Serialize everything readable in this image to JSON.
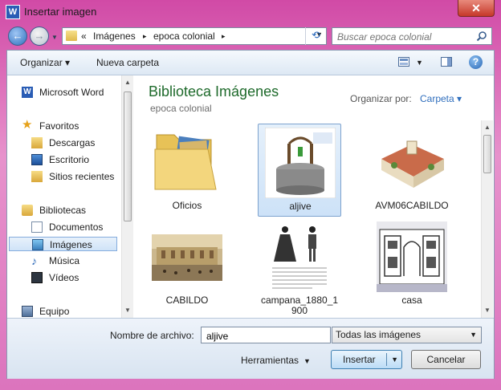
{
  "window": {
    "title": "Insertar imagen",
    "app_icon": "W",
    "close_glyph": "✕"
  },
  "nav": {
    "back_glyph": "←",
    "forward_glyph": "→",
    "breadcrumb": {
      "prefix": "«",
      "parts": [
        "Imágenes",
        "epoca colonial"
      ],
      "sep": "▸"
    },
    "refresh_glyph": "⟲",
    "search_placeholder": "Buscar epoca colonial"
  },
  "toolbar": {
    "organize": "Organizar ▾",
    "new_folder": "Nueva carpeta",
    "help": "?"
  },
  "sidebar": {
    "items": [
      {
        "label": "Microsoft Word",
        "icon": "word-icon"
      },
      {
        "label": "Favoritos",
        "icon": "star-icon"
      },
      {
        "label": "Descargas",
        "icon": "downloads-icon"
      },
      {
        "label": "Escritorio",
        "icon": "desktop-icon"
      },
      {
        "label": "Sitios recientes",
        "icon": "recent-places-icon"
      },
      {
        "label": "Bibliotecas",
        "icon": "libraries-icon"
      },
      {
        "label": "Documentos",
        "icon": "documents-icon"
      },
      {
        "label": "Imágenes",
        "icon": "pictures-icon"
      },
      {
        "label": "Música",
        "icon": "music-icon"
      },
      {
        "label": "Vídeos",
        "icon": "videos-icon"
      },
      {
        "label": "Equipo",
        "icon": "computer-icon"
      }
    ]
  },
  "library": {
    "title": "Biblioteca Imágenes",
    "subtitle": "epoca colonial",
    "arrange_label": "Organizar por:",
    "arrange_value": "Carpeta ▾"
  },
  "files": [
    {
      "name": "Oficios",
      "type": "folder"
    },
    {
      "name": "aljive",
      "type": "image",
      "selected": true
    },
    {
      "name": "AVM06CABILDO",
      "type": "image"
    },
    {
      "name": "CABILDO",
      "type": "image"
    },
    {
      "name": "campana_1880_1900",
      "type": "image"
    },
    {
      "name": "casa",
      "type": "image"
    }
  ],
  "footer": {
    "filename_label": "Nombre de archivo:",
    "filename_value": "aljive",
    "filetype": "Todas las imágenes",
    "tools": "Herramientas",
    "insert": "Insertar",
    "cancel": "Cancelar"
  },
  "colors": {
    "accent": "#2f6ebd",
    "library_title": "#1e6a2b",
    "frame": "#d14aa6"
  }
}
